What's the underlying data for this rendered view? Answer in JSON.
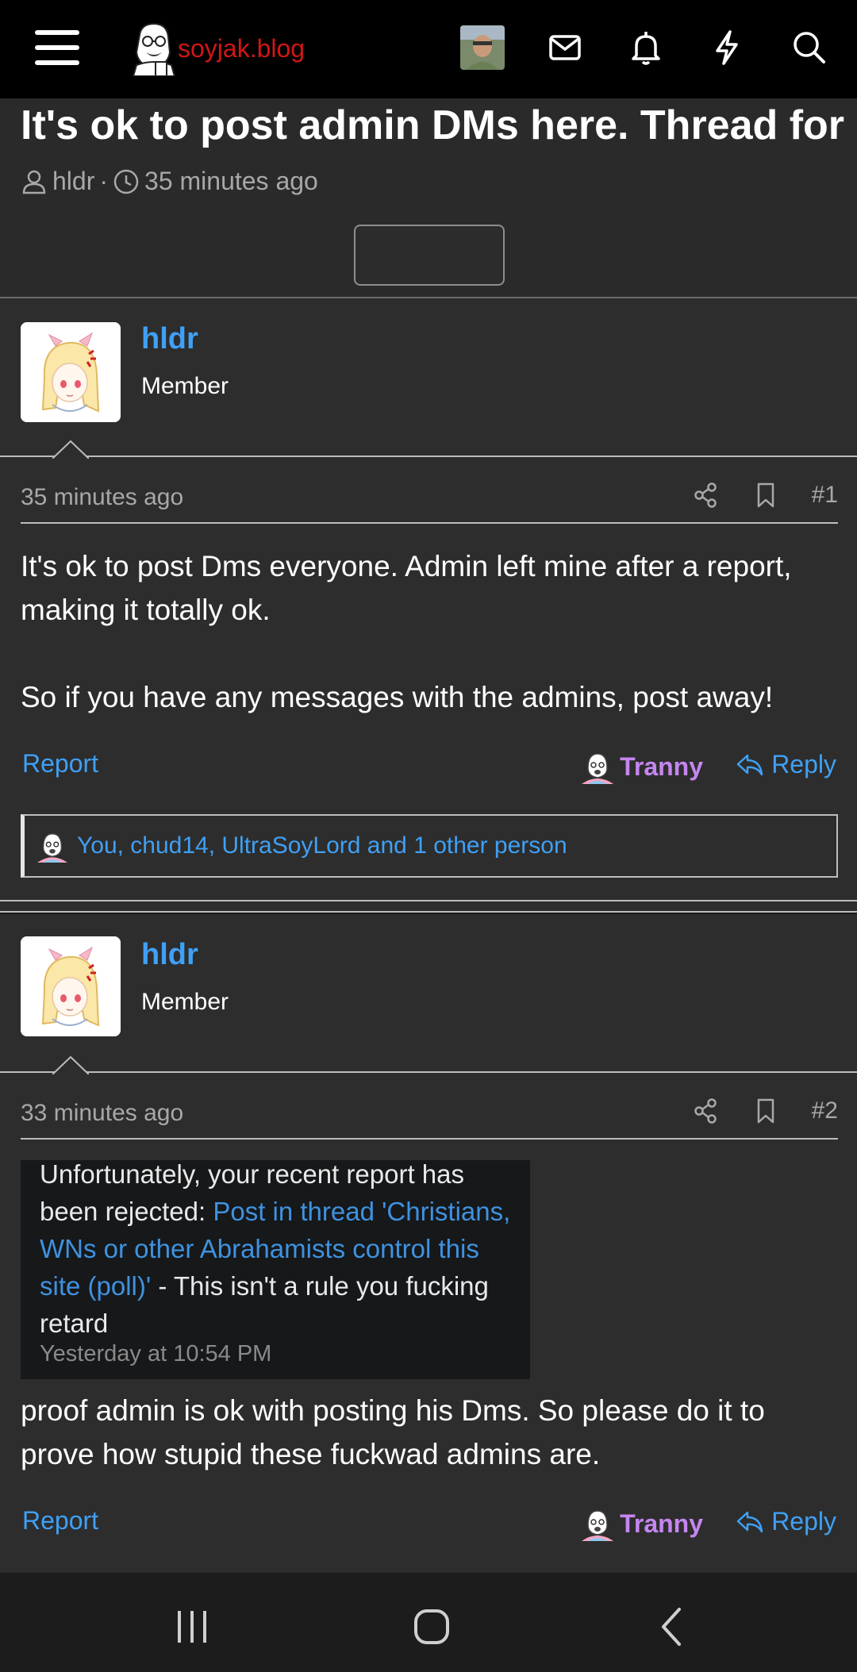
{
  "header": {
    "site_name": "soyjak.blog",
    "icons": [
      "menu-icon",
      "user-avatar",
      "envelope-icon",
      "bell-icon",
      "bolt-icon",
      "search-icon"
    ]
  },
  "thread": {
    "title": "It's ok to post admin DMs here. Thread for it",
    "author": "hldr",
    "separator": "·",
    "time": "35 minutes ago"
  },
  "posts": [
    {
      "username": "hldr",
      "user_title": "Member",
      "time": "35 minutes ago",
      "number": "#1",
      "body": [
        "It's ok to post Dms everyone. Admin left mine after a report, making it totally ok.",
        "So if you have any messages with the admins, post away!"
      ],
      "report_label": "Report",
      "reaction_label": "Tranny",
      "reply_label": "Reply",
      "reactions_summary": "You, chud14, UltraSoyLord and 1 other person"
    },
    {
      "username": "hldr",
      "user_title": "Member",
      "time": "33 minutes ago",
      "number": "#2",
      "attachment": {
        "line1": "Unfortunately, your recent report has",
        "line2_prefix": "been rejected: ",
        "link": "Post in thread 'Christians, WNs or other Abrahamists control this site (poll)'",
        "suffix": " - This isn't a rule you fucking retard",
        "timestamp": "Yesterday at 10:54 PM"
      },
      "body": "proof admin is ok with posting his Dms. So please do it to prove how stupid these fuckwad admins are.",
      "report_label": "Report",
      "reaction_label": "Tranny",
      "reply_label": "Reply"
    }
  ],
  "colors": {
    "link": "#3fa0f5",
    "brand_red": "#d01616",
    "reaction": "#c586f0",
    "background": "#2d2d2d"
  }
}
